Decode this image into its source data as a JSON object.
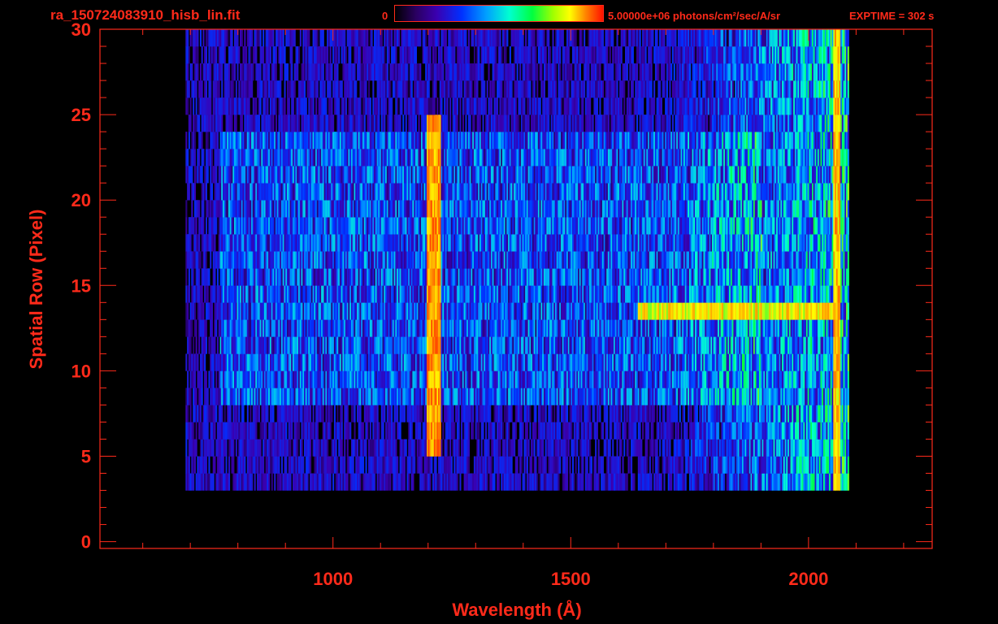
{
  "header": {
    "title": "ra_150724083910_hisb_lin.fit",
    "colorbar_min": "0",
    "colorbar_max": "5.00000e+06 photons/cm²/sec/A/sr",
    "exptime": "EXPTIME = 302 s"
  },
  "chart_data": {
    "type": "heatmap",
    "title": "ra_150724083910_hisb_lin.fit",
    "xlabel": "Wavelength (Å)",
    "ylabel": "Spatial Row (Pixel)",
    "xlim": [
      510,
      2260
    ],
    "ylim": [
      -0.4,
      30
    ],
    "x_ticks": [
      1000,
      1500,
      2000
    ],
    "y_ticks": [
      0,
      5,
      10,
      15,
      20,
      25,
      30
    ],
    "colorscale": [
      "#000000",
      "#3a00b0",
      "#0030ff",
      "#00a0ff",
      "#00ffd0",
      "#00ff40",
      "#ffff00",
      "#ff8000",
      "#ff1000"
    ],
    "colorbar_range": [
      0,
      5000000
    ],
    "colorbar_units": "photons/cm²/sec/A/sr",
    "exptime_s": 302,
    "features": [
      {
        "x_range": [
          1195,
          1225
        ],
        "rows": [
          5,
          24
        ],
        "intensity": 0.95
      },
      {
        "x_range": [
          1640,
          2060
        ],
        "rows": [
          12.5,
          13.5
        ],
        "intensity": 0.85
      },
      {
        "x_range": [
          2050,
          2065
        ],
        "rows": [
          3,
          29
        ],
        "intensity": 0.9
      }
    ]
  }
}
